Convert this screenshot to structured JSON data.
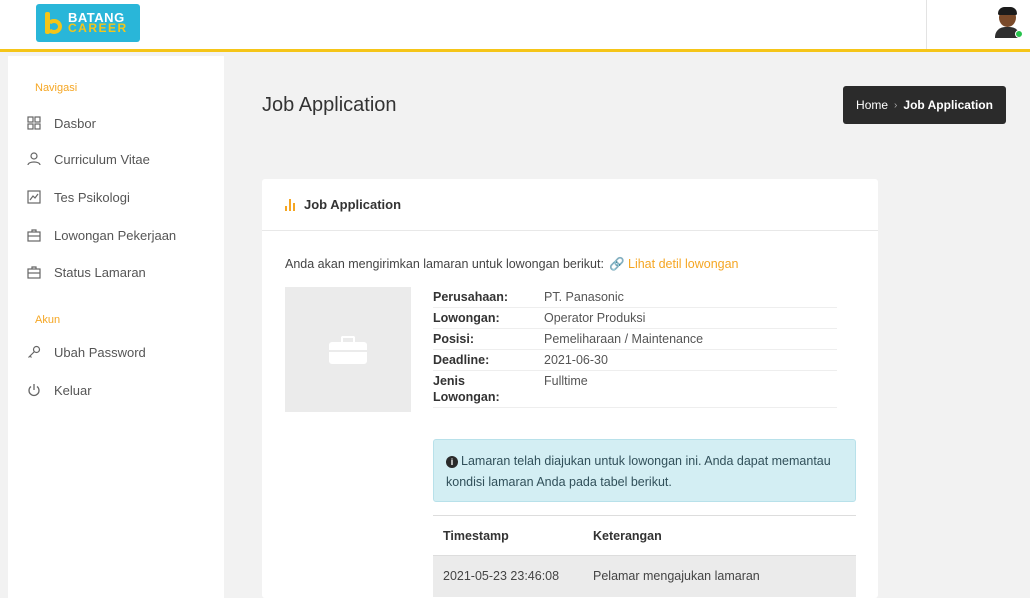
{
  "app": {
    "logo_line1": "BATANG",
    "logo_line2": "CAREER",
    "brand_colors": {
      "primary": "#29b6d9",
      "accent": "#f5c518"
    }
  },
  "sidebar": {
    "nav_heading": "Navigasi",
    "nav_items": [
      {
        "label": "Dasbor",
        "icon": "dashboard-icon"
      },
      {
        "label": "Curriculum Vitae",
        "icon": "user-icon"
      },
      {
        "label": "Tes Psikologi",
        "icon": "chart-icon"
      },
      {
        "label": "Lowongan Pekerjaan",
        "icon": "briefcase-icon"
      },
      {
        "label": "Status Lamaran",
        "icon": "briefcase-icon"
      }
    ],
    "account_heading": "Akun",
    "account_items": [
      {
        "label": "Ubah Password",
        "icon": "key-icon"
      },
      {
        "label": "Keluar",
        "icon": "power-icon"
      }
    ]
  },
  "page": {
    "title": "Job Application",
    "breadcrumb": {
      "home": "Home",
      "current": "Job Application"
    }
  },
  "card": {
    "title": "Job Application",
    "intro_text": "Anda akan mengirimkan lamaran untuk lowongan berikut:",
    "detail_link": "Lihat detil lowongan",
    "details": [
      {
        "key": "Perusahaan:",
        "value": "PT. Panasonic"
      },
      {
        "key": "Lowongan:",
        "value": "Operator Produksi"
      },
      {
        "key": "Posisi:",
        "value": "Pemeliharaan / Maintenance"
      },
      {
        "key": "Deadline:",
        "value": "2021-06-30"
      },
      {
        "key": "Jenis Lowongan:",
        "value": "Fulltime"
      }
    ],
    "alert_text": "Lamaran telah diajukan untuk lowongan ini. Anda dapat memantau kondisi lamaran Anda pada tabel berikut.",
    "log": {
      "headers": [
        "Timestamp",
        "Keterangan"
      ],
      "rows": [
        [
          "2021-05-23 23:46:08",
          "Pelamar mengajukan lamaran"
        ]
      ]
    }
  }
}
